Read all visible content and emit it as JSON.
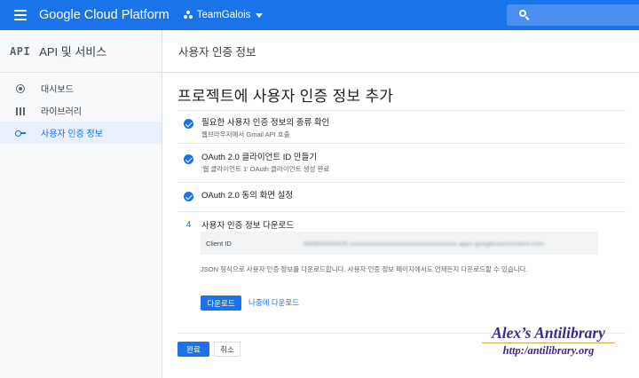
{
  "topbar": {
    "brand": "Google Cloud Platform",
    "project": "TeamGalois"
  },
  "sidebar": {
    "logo": "API",
    "title": "API 및 서비스",
    "items": [
      {
        "label": "대시보드",
        "icon": "dashboard-icon",
        "active": false
      },
      {
        "label": "라이브러리",
        "icon": "library-icon",
        "active": false
      },
      {
        "label": "사용자 인증 정보",
        "icon": "key-icon",
        "active": true
      }
    ]
  },
  "main": {
    "header": "사용자 인증 정보",
    "title": "프로젝트에 사용자 인증 정보 추가",
    "steps": [
      {
        "status": "done",
        "title": "필요한 사용자 인증 정보의 종류 확인",
        "subtitle": "웹브라우저에서 Gmail API 호출"
      },
      {
        "status": "done",
        "title": "OAuth 2.0 클라이언트 ID 만들기",
        "subtitle": "'웹 클라이언트 1' OAuth 클라이언트 생성 완료"
      },
      {
        "status": "done",
        "title": "OAuth 2.0 동의 화면 설정",
        "subtitle": ""
      },
      {
        "status": "current",
        "number": "4",
        "title": "사용자 인증 정보 다운로드",
        "subtitle": ""
      }
    ],
    "client_id": {
      "label": "Client ID",
      "value": "660600000405-xxxxxxxxxxxxxxxxxxxxxxxxxxxxxxxx.apps.googleusercontent.com"
    },
    "json_note": "JSON 형식으로 사용자 인증 정보를 다운로드합니다. 사용자 인증 정보 페이지에서도 언제든지 다운로드할 수 있습니다.",
    "download_label": "다운로드",
    "download_later_label": "나중에 다운로드",
    "done_label": "완료",
    "cancel_label": "취소"
  },
  "watermark": {
    "title": "Alex’s Antilibrary",
    "url": "http:/antilibrary.org"
  },
  "colors": {
    "accent": "#1a73e8",
    "sidebar_bg": "#f8f9fa",
    "active_bg": "#e8f0fe",
    "watermark": "#3c2a8a"
  }
}
